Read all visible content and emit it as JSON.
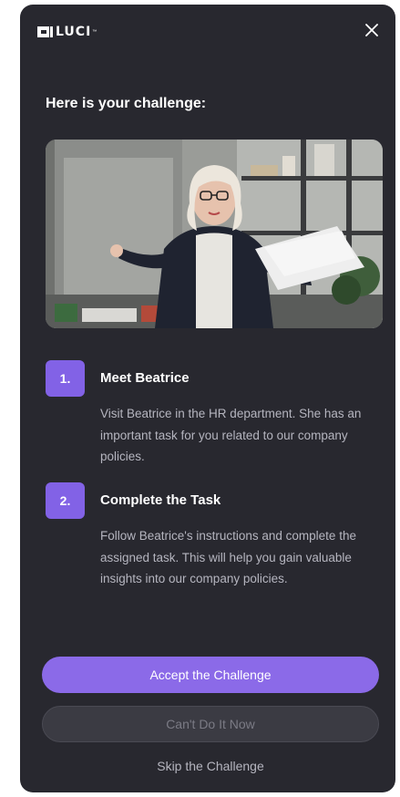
{
  "brand": {
    "logo_text": "LUCI",
    "trademark": "™"
  },
  "header": {
    "close_icon": "close-icon"
  },
  "challenge": {
    "heading": "Here is your challenge:",
    "image_description": "office-worker-photo",
    "steps": [
      {
        "number": "1.",
        "title": "Meet Beatrice",
        "description": "Visit Beatrice in the HR department. She has an important task for you related to our company policies."
      },
      {
        "number": "2.",
        "title": "Complete the Task",
        "description": "Follow Beatrice's instructions and complete the assigned task. This will help you gain valuable insights into our company policies."
      }
    ]
  },
  "actions": {
    "accept_label": "Accept the Challenge",
    "later_label": "Can't Do It Now",
    "skip_label": "Skip the Challenge"
  },
  "colors": {
    "panel_bg": "#28282f",
    "accent": "#8b6ae8",
    "badge": "#8262e6",
    "muted_text": "#b5b5bf",
    "secondary_button_bg": "#3b3b43"
  }
}
